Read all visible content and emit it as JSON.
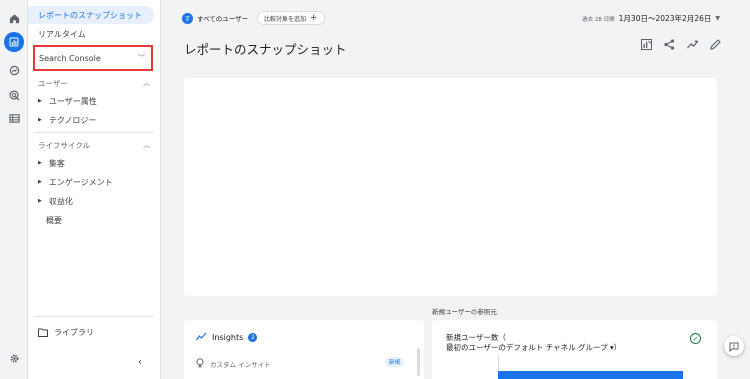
{
  "rail": {
    "icons": [
      "home-icon",
      "reports-icon",
      "explore-icon",
      "advertising-icon",
      "configure-icon",
      "settings-icon"
    ]
  },
  "sidebar": {
    "items": [
      {
        "label": "レポートのスナップショット"
      },
      {
        "label": "リアルタイム"
      },
      {
        "label": "Search Console"
      },
      {
        "label": "ユーザー"
      },
      {
        "label": "ユーザー属性"
      },
      {
        "label": "テクノロジー"
      },
      {
        "label": "ライフサイクル"
      },
      {
        "label": "集客"
      },
      {
        "label": "エンゲージメント"
      },
      {
        "label": "収益化"
      },
      {
        "label": "概要"
      }
    ],
    "library": "ライブラリ"
  },
  "topbar": {
    "audience_avatar": "す",
    "audience": "すべてのユーザー",
    "compare": "比較対象を追加",
    "date_label": "過去 28 日間",
    "date_range": "1月30日～2023年2月26日"
  },
  "main": {
    "title": "レポートのスナップショット"
  },
  "insights": {
    "title": "Insights",
    "count": "2",
    "row_label": "カスタム インサイト",
    "badge": "新規"
  },
  "referral": {
    "section_title": "新規ユーザーの参照元",
    "line1": "新規ユーザー数（",
    "line2": "最初のユーザーのデフォルト チャネル グループ ▾）"
  },
  "colors": {
    "accent": "#1a73e8",
    "highlight_border": "#e53935",
    "ok": "#188038"
  }
}
